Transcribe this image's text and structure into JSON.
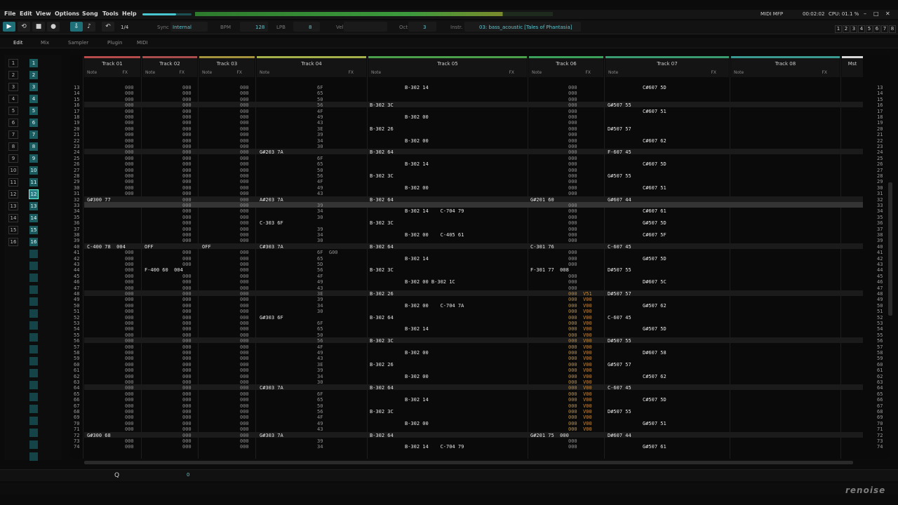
{
  "menu": [
    "File",
    "Edit",
    "View",
    "Options",
    "Song",
    "Tools",
    "Help"
  ],
  "status": {
    "midi": "MIDI MFP",
    "time": "00:02:02",
    "cpu": "CPU: 01.1 %"
  },
  "toolbar": {
    "step_value": "1/4",
    "sync_label": "Sync",
    "sync_value": "Internal",
    "bpm_label": "BPM",
    "bpm_value": "128",
    "lpb_label": "LPB",
    "lpb_value": "8",
    "vel_label": "Vel",
    "oct_label": "Oct",
    "oct_value": "3",
    "instr_label": "Instr.",
    "instr_value": "03: bass_acoustic [Tales of Phantasia]",
    "right_nums": [
      "1",
      "2",
      "3",
      "4",
      "5",
      "6",
      "7",
      "8"
    ]
  },
  "tabs": [
    {
      "label": "Edit",
      "active": true
    },
    {
      "label": "Mix"
    },
    {
      "label": "Sampler"
    },
    {
      "label": "Plugin"
    },
    {
      "label": "MIDI"
    }
  ],
  "sequence": [
    "1",
    "2",
    "3",
    "4",
    "5",
    "6",
    "7",
    "8",
    "9",
    "10",
    "11",
    "12",
    "13",
    "14",
    "15",
    "16"
  ],
  "tracks": [
    {
      "name": "Track 01",
      "color": "#b44a4a"
    },
    {
      "name": "Track 02",
      "color": "#a84c4c"
    },
    {
      "name": "Track 03",
      "color": "#a4923c"
    },
    {
      "name": "Track 04",
      "color": "#a6b04a"
    },
    {
      "name": "Track 05",
      "color": "#4aa04a"
    },
    {
      "name": "Track 06",
      "color": "#3aa05a"
    },
    {
      "name": "Track 07",
      "color": "#3a9a70"
    },
    {
      "name": "Track 08",
      "color": "#3a9a90"
    },
    {
      "name": "Mst",
      "color": "#d8d8d8"
    }
  ],
  "column_labels": {
    "note": "Note",
    "fx": "FX",
    "play": "PLAY"
  },
  "rows": [
    {
      "n": "13",
      "c": [
        "000",
        "000",
        "000",
        "6F",
        "B-302 14",
        "000",
        "C#607 5D",
        ""
      ]
    },
    {
      "n": "14",
      "c": [
        "000",
        "000",
        "000",
        "65",
        "",
        "000",
        "",
        ""
      ]
    },
    {
      "n": "15",
      "c": [
        "000",
        "000",
        "000",
        "50",
        "",
        "000",
        "",
        ""
      ]
    },
    {
      "n": "16",
      "c": [
        "000",
        "000",
        "000",
        "56",
        "B-302 3C",
        "000",
        "G#507 55",
        ""
      ]
    },
    {
      "n": "17",
      "c": [
        "000",
        "000",
        "000",
        "4F",
        "",
        "000",
        "C#607 51",
        ""
      ]
    },
    {
      "n": "18",
      "c": [
        "000",
        "000",
        "000",
        "49",
        "B-302 00",
        "000",
        "",
        ""
      ]
    },
    {
      "n": "19",
      "c": [
        "000",
        "000",
        "000",
        "43",
        "",
        "000",
        "",
        ""
      ]
    },
    {
      "n": "20",
      "c": [
        "000",
        "000",
        "000",
        "3E",
        "B-302 26",
        "000",
        "D#507 57",
        ""
      ]
    },
    {
      "n": "21",
      "c": [
        "000",
        "000",
        "000",
        "39",
        "",
        "000",
        "",
        ""
      ]
    },
    {
      "n": "22",
      "c": [
        "000",
        "000",
        "000",
        "34",
        "B-302 00",
        "000",
        "C#607 62",
        ""
      ]
    },
    {
      "n": "23",
      "c": [
        "000",
        "000",
        "000",
        "30",
        "",
        "000",
        "",
        ""
      ]
    },
    {
      "n": "24",
      "c": [
        "000",
        "000",
        "000",
        "G#203 7A",
        "B-302 64",
        "000",
        "F-607 45",
        ""
      ]
    },
    {
      "n": "25",
      "c": [
        "000",
        "000",
        "000",
        "6F",
        "",
        "000",
        "",
        ""
      ]
    },
    {
      "n": "26",
      "c": [
        "000",
        "000",
        "000",
        "65",
        "B-302 14",
        "000",
        "C#607 5D",
        ""
      ]
    },
    {
      "n": "27",
      "c": [
        "000",
        "000",
        "000",
        "50",
        "",
        "000",
        "",
        ""
      ]
    },
    {
      "n": "28",
      "c": [
        "000",
        "000",
        "000",
        "56",
        "B-302 3C",
        "000",
        "G#507 55",
        ""
      ]
    },
    {
      "n": "29",
      "c": [
        "000",
        "000",
        "000",
        "4F",
        "",
        "000",
        "",
        ""
      ]
    },
    {
      "n": "30",
      "c": [
        "000",
        "000",
        "000",
        "49",
        "B-302 00",
        "000",
        "C#607 51",
        ""
      ]
    },
    {
      "n": "31",
      "c": [
        "000",
        "000",
        "000",
        "43",
        "",
        "000",
        "",
        ""
      ]
    },
    {
      "n": "32",
      "c": [
        "G#300 77",
        "000",
        "000",
        "A#203 7A",
        "B-302 64",
        "G#201 60",
        "G#607 44",
        ""
      ]
    },
    {
      "n": "33",
      "c": [
        "",
        "000",
        "000",
        "39",
        "",
        "000",
        "",
        ""
      ]
    },
    {
      "n": "34",
      "c": [
        "",
        "000",
        "000",
        "34",
        "B-302 14    C-704 79",
        "000",
        "C#607 61",
        ""
      ]
    },
    {
      "n": "35",
      "c": [
        "",
        "000",
        "000",
        "30",
        "",
        "000",
        "",
        ""
      ]
    },
    {
      "n": "36",
      "c": [
        "",
        "000",
        "000",
        "C-303 6F",
        "B-302 3C",
        "000",
        "G#507 5D",
        ""
      ]
    },
    {
      "n": "37",
      "c": [
        "",
        "000",
        "000",
        "39",
        "",
        "000",
        "",
        ""
      ]
    },
    {
      "n": "38",
      "c": [
        "",
        "000",
        "000",
        "34",
        "B-302 00    C-405 61",
        "000",
        "C#607 5F",
        ""
      ]
    },
    {
      "n": "39",
      "c": [
        "",
        "000",
        "000",
        "30",
        "",
        "000",
        "",
        ""
      ]
    },
    {
      "n": "40",
      "c": [
        "C-400 78  004",
        "OFF",
        "OFF",
        "C#303 7A",
        "B-302 64",
        "C-301 76",
        "C-607 45",
        ""
      ]
    },
    {
      "n": "41",
      "c": [
        "000",
        "000",
        "000",
        "6F  G00",
        "",
        "000",
        "",
        ""
      ]
    },
    {
      "n": "42",
      "c": [
        "000",
        "000",
        "000",
        "65",
        "B-302 14",
        "000",
        "G#507 5D",
        ""
      ]
    },
    {
      "n": "43",
      "c": [
        "000",
        "000",
        "000",
        "5D",
        "",
        "000",
        "",
        ""
      ]
    },
    {
      "n": "44",
      "c": [
        "000",
        "F-400 60  004",
        "000",
        "56",
        "B-302 3C",
        "F-301 77  008",
        "D#507 55",
        ""
      ]
    },
    {
      "n": "45",
      "c": [
        "000",
        "000",
        "000",
        "4F",
        "",
        "000",
        "",
        ""
      ]
    },
    {
      "n": "46",
      "c": [
        "000",
        "000",
        "000",
        "49",
        "B-302 00 B-302 1C",
        "000",
        "D#607 5C",
        ""
      ]
    },
    {
      "n": "47",
      "c": [
        "000",
        "000",
        "000",
        "43",
        "",
        "000",
        "",
        ""
      ]
    },
    {
      "n": "48",
      "c": [
        "000",
        "000",
        "000",
        "3E",
        "B-302 26",
        "000  V51",
        "D#507 57",
        ""
      ]
    },
    {
      "n": "49",
      "c": [
        "000",
        "000",
        "000",
        "39",
        "",
        "000  V00",
        "",
        ""
      ]
    },
    {
      "n": "50",
      "c": [
        "000",
        "000",
        "000",
        "34",
        "B-302 00    C-704 7A",
        "000  V00",
        "G#507 62",
        ""
      ]
    },
    {
      "n": "51",
      "c": [
        "000",
        "000",
        "000",
        "30",
        "",
        "000  V00",
        "",
        ""
      ]
    },
    {
      "n": "52",
      "c": [
        "000",
        "000",
        "000",
        "G#303 6F",
        "B-302 64",
        "000  V00",
        "C-607 45",
        ""
      ]
    },
    {
      "n": "53",
      "c": [
        "000",
        "000",
        "000",
        "6F",
        "",
        "000  V00",
        "",
        ""
      ]
    },
    {
      "n": "54",
      "c": [
        "000",
        "000",
        "000",
        "65",
        "B-302 14",
        "000  V00",
        "G#507 5D",
        ""
      ]
    },
    {
      "n": "55",
      "c": [
        "000",
        "000",
        "000",
        "50",
        "",
        "000  V00",
        "",
        ""
      ]
    },
    {
      "n": "56",
      "c": [
        "000",
        "000",
        "000",
        "56",
        "B-302 3C",
        "000  V00",
        "D#507 55",
        ""
      ]
    },
    {
      "n": "57",
      "c": [
        "000",
        "000",
        "000",
        "4F",
        "",
        "000  V00",
        "",
        ""
      ]
    },
    {
      "n": "58",
      "c": [
        "000",
        "000",
        "000",
        "49",
        "B-302 00",
        "000  V00",
        "D#607 58",
        ""
      ]
    },
    {
      "n": "59",
      "c": [
        "000",
        "000",
        "000",
        "43",
        "",
        "000  V00",
        "",
        ""
      ]
    },
    {
      "n": "60",
      "c": [
        "000",
        "000",
        "000",
        "3E",
        "B-302 26",
        "000  V00",
        "G#507 57",
        ""
      ]
    },
    {
      "n": "61",
      "c": [
        "000",
        "000",
        "000",
        "39",
        "",
        "000  V00",
        "",
        ""
      ]
    },
    {
      "n": "62",
      "c": [
        "000",
        "000",
        "000",
        "34",
        "B-302 00",
        "000  V00",
        "C#507 62",
        ""
      ]
    },
    {
      "n": "63",
      "c": [
        "000",
        "000",
        "000",
        "30",
        "",
        "000  V00",
        "",
        ""
      ]
    },
    {
      "n": "64",
      "c": [
        "000",
        "000",
        "000",
        "C#303 7A",
        "B-302 64",
        "000  V00",
        "C-607 45",
        ""
      ]
    },
    {
      "n": "65",
      "c": [
        "000",
        "000",
        "000",
        "6F",
        "",
        "000  V00",
        "",
        ""
      ]
    },
    {
      "n": "66",
      "c": [
        "000",
        "000",
        "000",
        "65",
        "B-302 14",
        "000  V00",
        "C#507 5D",
        ""
      ]
    },
    {
      "n": "67",
      "c": [
        "000",
        "000",
        "000",
        "50",
        "",
        "000  V00",
        "",
        ""
      ]
    },
    {
      "n": "68",
      "c": [
        "000",
        "000",
        "000",
        "56",
        "B-302 3C",
        "000  V00",
        "D#507 55",
        ""
      ]
    },
    {
      "n": "69",
      "c": [
        "000",
        "000",
        "000",
        "4F",
        "",
        "000  V00",
        "",
        ""
      ]
    },
    {
      "n": "70",
      "c": [
        "000",
        "000",
        "000",
        "49",
        "B-302 00",
        "000  V00",
        "G#507 51",
        ""
      ]
    },
    {
      "n": "71",
      "c": [
        "000",
        "000",
        "000",
        "43",
        "",
        "000  V00",
        "",
        ""
      ]
    },
    {
      "n": "72",
      "c": [
        "G#300 68",
        "000",
        "000",
        "G#303 7A",
        "B-302 64",
        "G#201 75  000",
        "D#607 44",
        ""
      ]
    },
    {
      "n": "73",
      "c": [
        "000",
        "000",
        "000",
        "39",
        "",
        "000",
        "",
        ""
      ]
    },
    {
      "n": "74",
      "c": [
        "000",
        "000",
        "000",
        "34",
        "B-302 14    C-704 79",
        "000",
        "G#507 61",
        ""
      ]
    }
  ],
  "bottom": {
    "q_label": "Q",
    "slot_value": "0"
  },
  "logo": "renoise"
}
